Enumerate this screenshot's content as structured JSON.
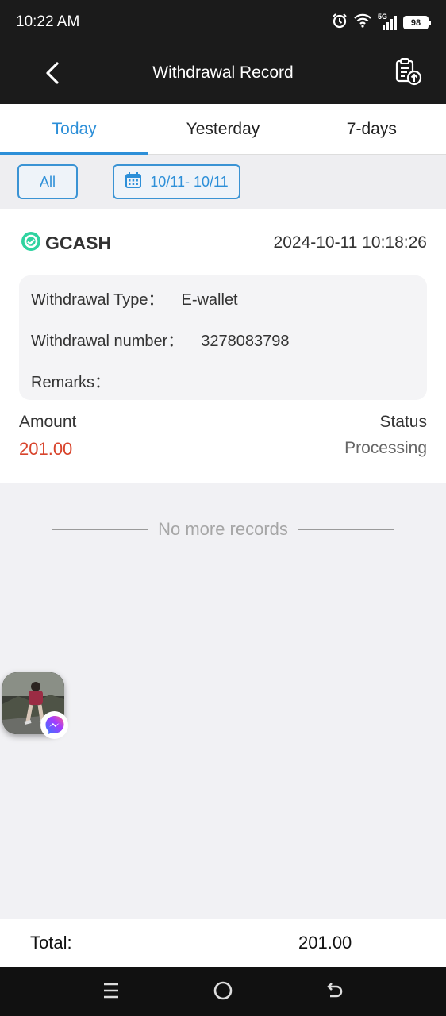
{
  "status_bar": {
    "time": "10:22 AM",
    "network": "5G",
    "battery": "98",
    "icons": [
      "alarm-icon",
      "wifi-icon",
      "signal-icon",
      "battery-icon"
    ]
  },
  "app_bar": {
    "title": "Withdrawal Record",
    "back_icon": "chevron-left-icon",
    "action_icon": "clipboard-upload-icon"
  },
  "tabs": [
    {
      "label": "Today",
      "active": true
    },
    {
      "label": "Yesterday",
      "active": false
    },
    {
      "label": "7-days",
      "active": false
    }
  ],
  "filters": {
    "all_label": "All",
    "date_range": "10/11- 10/11",
    "date_icon": "calendar-icon"
  },
  "record": {
    "provider": "GCASH",
    "datetime": "2024-10-11 10:18:26",
    "type_label": "Withdrawal Type：",
    "type_value": "E-wallet",
    "number_label": "Withdrawal number：",
    "number_value": "3278083798",
    "remarks_label": "Remarks：",
    "remarks_value": "",
    "amount_label": "Amount",
    "amount_value": "201.00",
    "status_label": "Status",
    "status_value": "Processing"
  },
  "list_end": "No more records",
  "footer": {
    "total_label": "Total:",
    "total_value": "201.00"
  },
  "colors": {
    "accent": "#2d8fd8",
    "amount": "#d8442c",
    "dark_bar": "#1b1b1b",
    "gcash_green": "#2fd3a0"
  },
  "nav_bar": {
    "icons": [
      "menu-icon",
      "home-circle-icon",
      "back-arrow-icon"
    ]
  }
}
